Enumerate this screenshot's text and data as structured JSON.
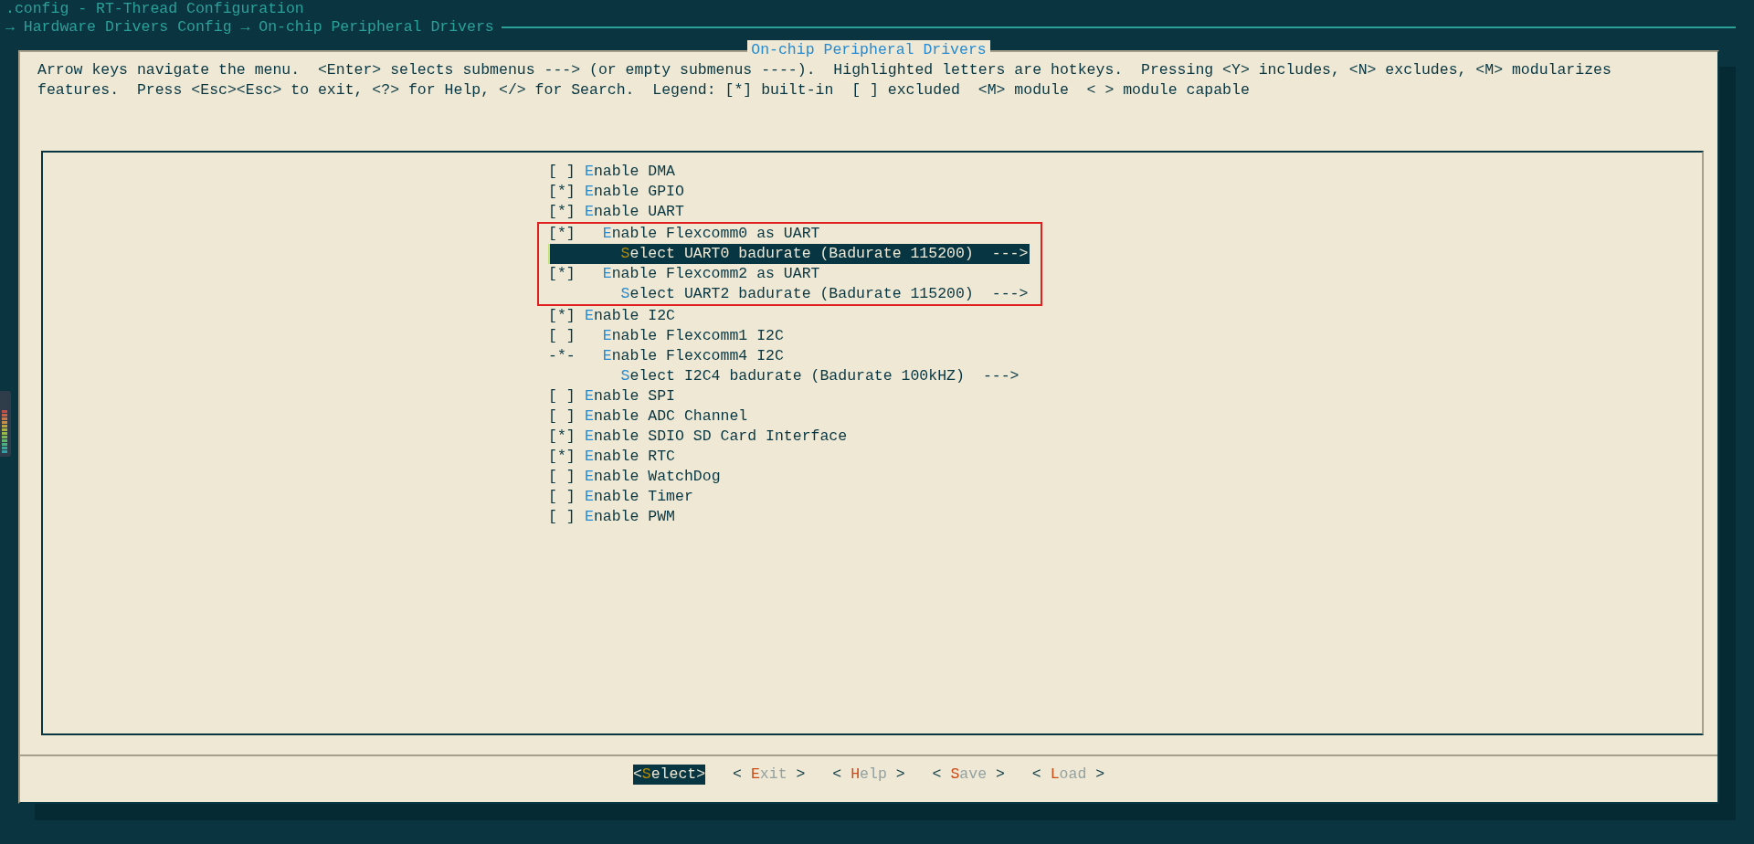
{
  "window": {
    "title": ".config - RT-Thread Configuration"
  },
  "breadcrumb": "→ Hardware Drivers Config → On-chip Peripheral Drivers",
  "dialog": {
    "title": "On-chip Peripheral Drivers",
    "help": [
      "Arrow keys navigate the menu.  <Enter> selects submenus ---> (or empty submenus ----).  Highlighted letters are hotkeys.  Pressing <Y> includes, <N> excludes, <M> modularizes",
      "features.  Press <Esc><Esc> to exit, <?> for Help, </> for Search.  Legend: [*] built-in  [ ] excluded  <M> module  < > module capable"
    ]
  },
  "menu": [
    {
      "prefix": "[ ]",
      "label": "Enable DMA",
      "selected": false,
      "highlighted": false
    },
    {
      "prefix": "[*]",
      "label": "Enable GPIO",
      "selected": false,
      "highlighted": false
    },
    {
      "prefix": "[*]",
      "label": "Enable UART",
      "selected": false,
      "highlighted": false,
      "children": [
        {
          "prefix": "[*]",
          "label": "Enable Flexcomm0 as UART",
          "selected": false,
          "highlighted": true,
          "children": [
            {
              "label": "Select UART0 badurate (Badurate 115200)",
              "suffix": "--->",
              "selected": true,
              "highlighted": true
            }
          ]
        },
        {
          "prefix": "[*]",
          "label": "Enable Flexcomm2 as UART",
          "selected": false,
          "highlighted": true,
          "children": [
            {
              "label": "Select UART2 badurate (Badurate 115200)",
              "suffix": "--->",
              "selected": false,
              "highlighted": true
            }
          ]
        }
      ]
    },
    {
      "prefix": "[*]",
      "label": "Enable I2C",
      "selected": false,
      "highlighted": false,
      "children": [
        {
          "prefix": "[ ]",
          "label": "Enable Flexcomm1 I2C",
          "selected": false,
          "highlighted": false
        },
        {
          "prefix": "-*-",
          "label": "Enable Flexcomm4 I2C",
          "selected": false,
          "highlighted": false,
          "children": [
            {
              "label": "Select I2C4 badurate (Badurate 100kHZ)",
              "suffix": "--->",
              "selected": false,
              "highlighted": false
            }
          ]
        }
      ]
    },
    {
      "prefix": "[ ]",
      "label": "Enable SPI",
      "selected": false,
      "highlighted": false
    },
    {
      "prefix": "[ ]",
      "label": "Enable ADC Channel",
      "selected": false,
      "highlighted": false
    },
    {
      "prefix": "[*]",
      "label": "Enable SDIO SD Card Interface",
      "selected": false,
      "highlighted": false
    },
    {
      "prefix": "[*]",
      "label": "Enable RTC",
      "selected": false,
      "highlighted": false
    },
    {
      "prefix": "[ ]",
      "label": "Enable WatchDog",
      "selected": false,
      "highlighted": false
    },
    {
      "prefix": "[ ]",
      "label": "Enable Timer",
      "selected": false,
      "highlighted": false
    },
    {
      "prefix": "[ ]",
      "label": "Enable PWM",
      "selected": false,
      "highlighted": false
    }
  ],
  "buttons": [
    {
      "left": "<",
      "label": "Select",
      "right": ">",
      "selected": true
    },
    {
      "left": "<",
      "label": "Exit",
      "right": ">",
      "selected": false
    },
    {
      "left": "<",
      "label": "Help",
      "right": ">",
      "selected": false
    },
    {
      "left": "<",
      "label": "Save",
      "right": ">",
      "selected": false
    },
    {
      "left": "<",
      "label": "Load",
      "right": ">",
      "selected": false
    }
  ]
}
